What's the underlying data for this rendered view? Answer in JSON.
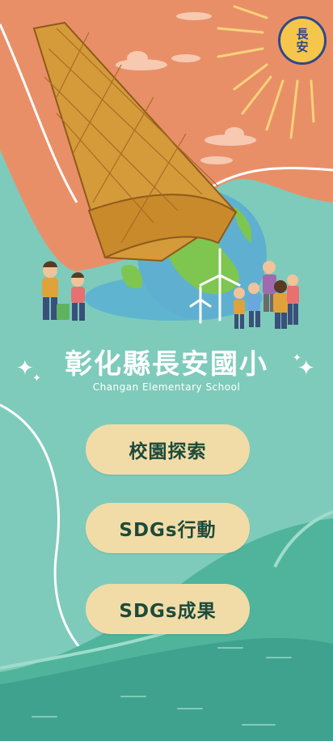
{
  "school": {
    "logo_text": "長安",
    "name": "彰化縣長安國小",
    "name_en": "Changan Elementary School"
  },
  "menu": {
    "items": [
      {
        "label": "校園探索"
      },
      {
        "label": "SDGs行動"
      },
      {
        "label": "SDGs成果"
      }
    ]
  },
  "colors": {
    "sky": "#e98f68",
    "sea": "#7ecbbb",
    "deep_sea": "#3fa28e",
    "button": "#f1dca8",
    "button_text": "#1d4a3a",
    "sun": "#f6c64a"
  }
}
